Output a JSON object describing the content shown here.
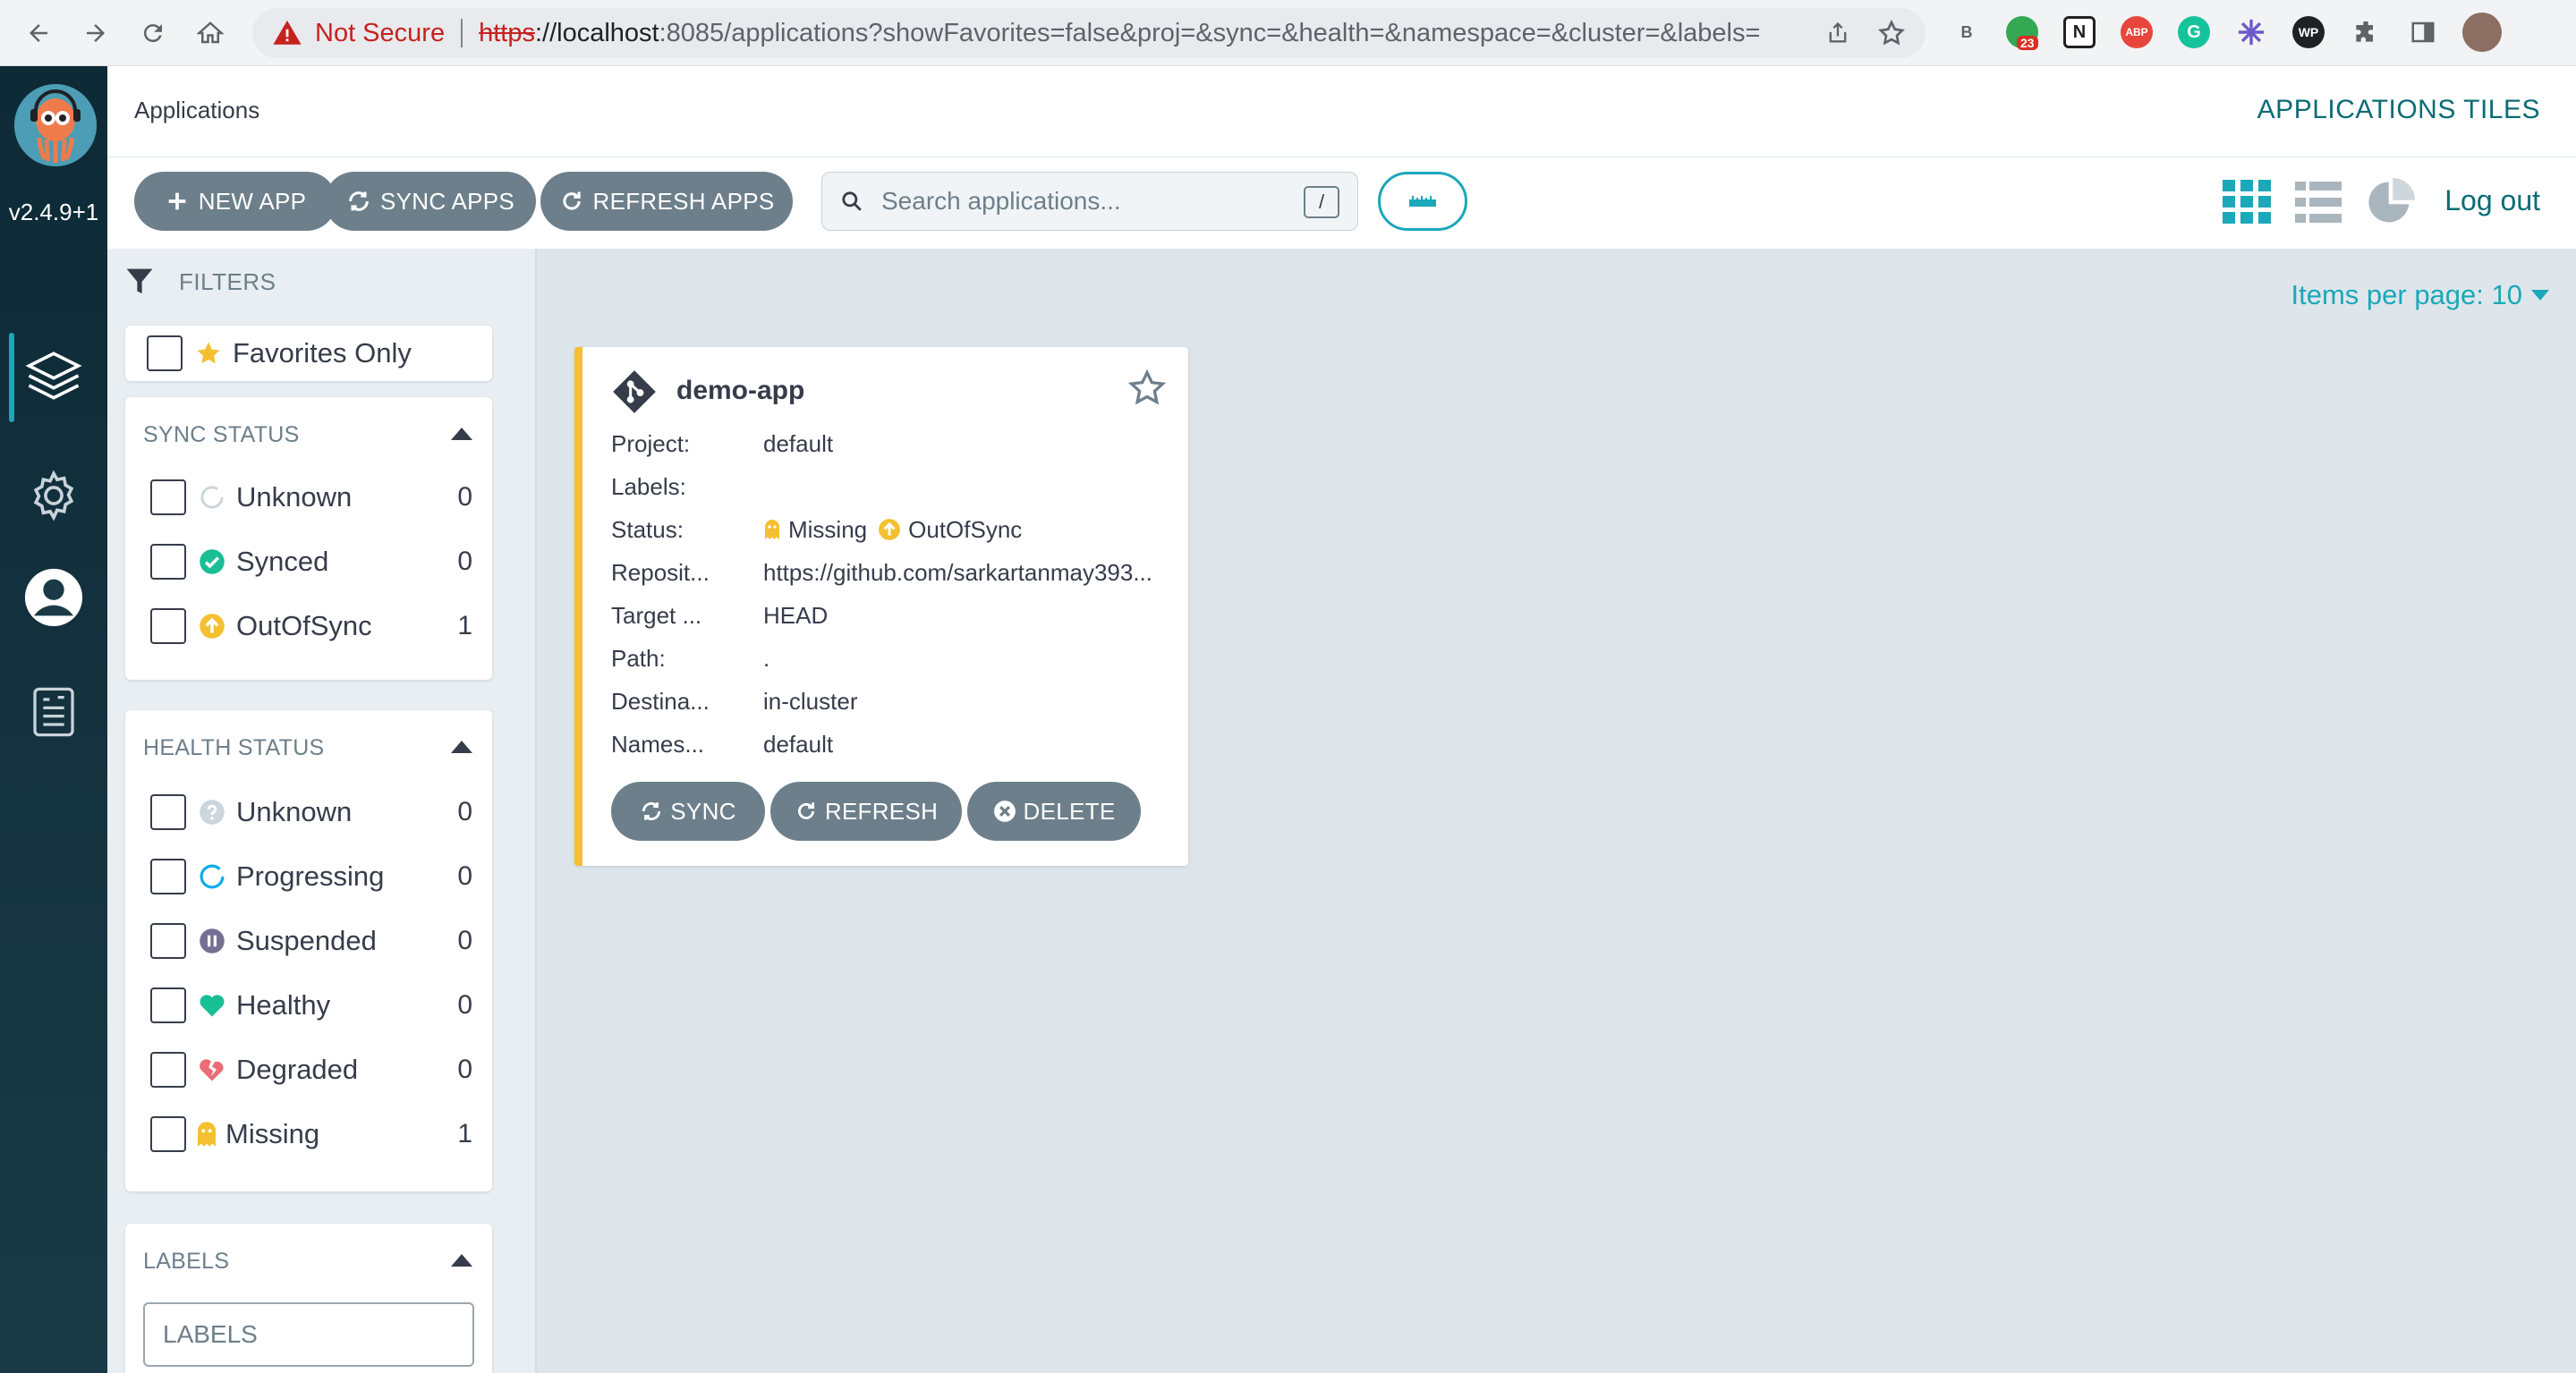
{
  "browser": {
    "security_label": "Not Secure",
    "url_scheme": "https",
    "url_host": "://localhost",
    "url_rest": ":8085/applications?showFavorites=false&proj=&sync=&health=&namespace=&cluster=&labels=",
    "ext_badge": "23"
  },
  "nav": {
    "version": "v2.4.9+1"
  },
  "header": {
    "title": "Applications",
    "right_title": "APPLICATIONS TILES"
  },
  "toolbar": {
    "new_app": "NEW APP",
    "sync_apps": "SYNC APPS",
    "refresh_apps": "REFRESH APPS",
    "search_placeholder": "Search applications...",
    "search_shortcut": "/",
    "logout": "Log out"
  },
  "filters": {
    "heading": "FILTERS",
    "favorites_label": "Favorites Only",
    "sync": {
      "title": "SYNC STATUS",
      "items": [
        {
          "label": "Unknown",
          "count": "0"
        },
        {
          "label": "Synced",
          "count": "0"
        },
        {
          "label": "OutOfSync",
          "count": "1"
        }
      ]
    },
    "health": {
      "title": "HEALTH STATUS",
      "items": [
        {
          "label": "Unknown",
          "count": "0"
        },
        {
          "label": "Progressing",
          "count": "0"
        },
        {
          "label": "Suspended",
          "count": "0"
        },
        {
          "label": "Healthy",
          "count": "0"
        },
        {
          "label": "Degraded",
          "count": "0"
        },
        {
          "label": "Missing",
          "count": "1"
        }
      ]
    },
    "labels": {
      "title": "LABELS",
      "placeholder": "LABELS"
    }
  },
  "main": {
    "items_per_page": "Items per page: 10",
    "app": {
      "name": "demo-app",
      "rows": [
        {
          "key": "Project:",
          "value": "default"
        },
        {
          "key": "Labels:",
          "value": ""
        },
        {
          "key": "Status:",
          "health": "Missing",
          "sync": "OutOfSync"
        },
        {
          "key": "Reposit...",
          "value": "https://github.com/sarkartanmay393..."
        },
        {
          "key": "Target ...",
          "value": "HEAD"
        },
        {
          "key": "Path:",
          "value": "."
        },
        {
          "key": "Destina...",
          "value": "in-cluster"
        },
        {
          "key": "Names...",
          "value": "default"
        }
      ],
      "actions": {
        "sync": "SYNC",
        "refresh": "REFRESH",
        "delete": "DELETE"
      }
    }
  },
  "colors": {
    "accent": "#1ba8b8",
    "button": "#6d7f8b",
    "out_of_sync": "#f4c030",
    "synced": "#18be94",
    "degraded": "#e96d76"
  }
}
